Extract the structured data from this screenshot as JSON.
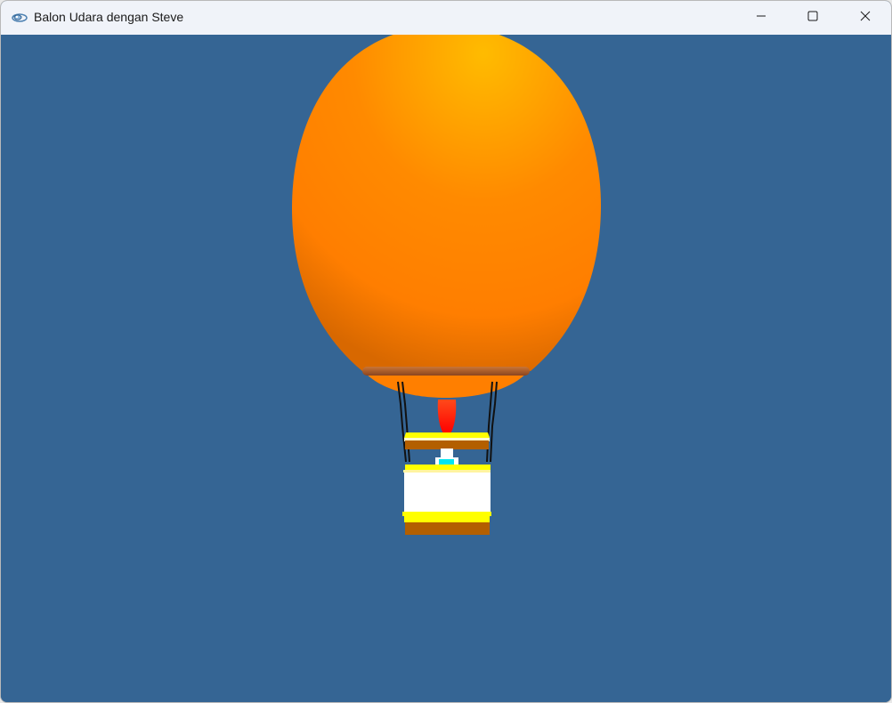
{
  "window": {
    "title": "Balon Udara dengan Steve",
    "app_icon": "opengl-app-icon",
    "controls": {
      "minimize": "minimize-icon",
      "maximize": "maximize-icon",
      "close": "close-icon"
    }
  },
  "scene": {
    "background_color": "#356594",
    "balloon_color": "#ff8a00",
    "balloon_highlight_color": "#ffbb00",
    "rim_color": "#b25a1c",
    "flame_color": "#ff1a00",
    "basket_body_color": "#ffffff",
    "basket_trim_color": "#ffff00",
    "basket_bottom_color": "#b35f00",
    "steve_head_color": "#00e5f0",
    "rope_color": "#111111"
  }
}
